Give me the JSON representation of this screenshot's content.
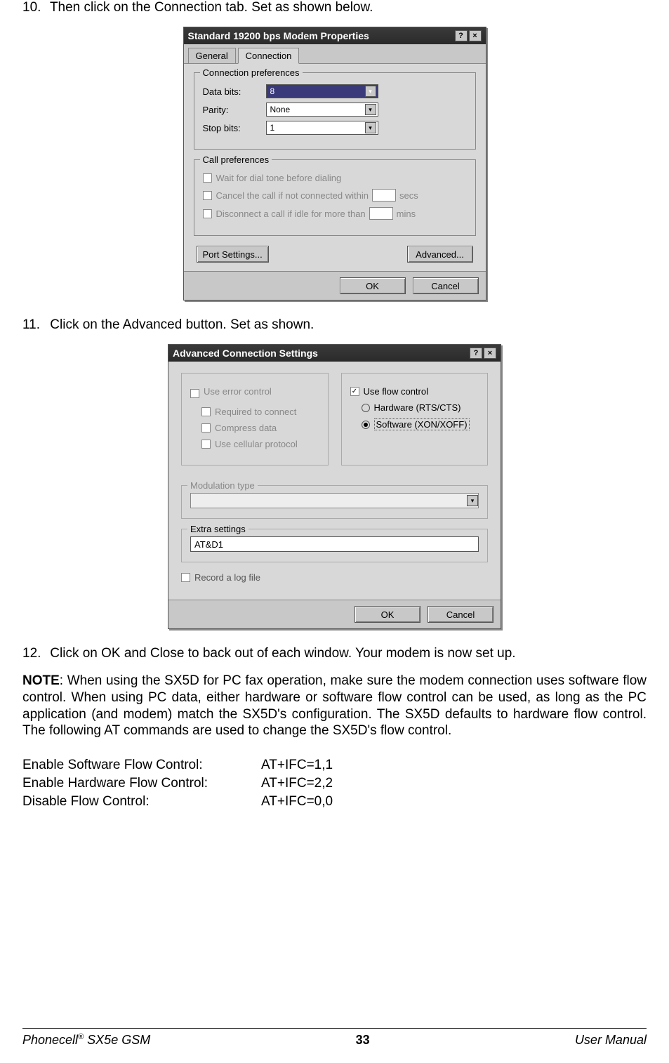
{
  "steps": {
    "s10": {
      "num": "10.",
      "text": "Then click on the Connection tab. Set as shown below."
    },
    "s11": {
      "num": "11.",
      "text": "Click on the Advanced button. Set as shown."
    },
    "s12": {
      "num": "12.",
      "text": "Click on OK and Close to back out of each window. Your modem is now set up."
    }
  },
  "dialog1": {
    "title": "Standard 19200 bps Modem Properties",
    "tabs": {
      "general": "General",
      "connection": "Connection"
    },
    "conn_pref": "Connection preferences",
    "databits": {
      "label": "Data bits:",
      "value": "8"
    },
    "parity": {
      "label": "Parity:",
      "value": "None"
    },
    "stopbits": {
      "label": "Stop bits:",
      "value": "1"
    },
    "call_pref": "Call preferences",
    "wait": "Wait for dial tone before dialing",
    "cancel": "Cancel the call if not connected within",
    "cancel_unit": "secs",
    "disconnect": "Disconnect a call if idle for more than",
    "disconnect_unit": "mins",
    "port": "Port Settings...",
    "advanced": "Advanced...",
    "ok": "OK",
    "cancelbtn": "Cancel"
  },
  "dialog2": {
    "title": "Advanced Connection Settings",
    "use_error": "Use error control",
    "required": "Required to connect",
    "compress": "Compress data",
    "cellular": "Use cellular protocol",
    "use_flow": "Use flow control",
    "hardware": "Hardware (RTS/CTS)",
    "software": "Software (XON/XOFF)",
    "modtype": "Modulation type",
    "extra": "Extra settings",
    "extra_val": "AT&D1",
    "record": "Record a log file",
    "ok": "OK",
    "cancel": "Cancel"
  },
  "note": {
    "label": "NOTE",
    "text": ": When using the SX5D for PC fax operation, make sure the modem connection uses software flow control. When using PC data, either hardware or software flow control can be used, as long as the PC application (and modem) match the SX5D's configuration. The SX5D defaults to hardware flow control. The following AT commands are used to change the SX5D's flow control."
  },
  "commands": [
    {
      "label": "Enable Software Flow Control:",
      "cmd": "AT+IFC=1,1"
    },
    {
      "label": "Enable Hardware Flow Control:",
      "cmd": "AT+IFC=2,2"
    },
    {
      "label": "Disable Flow Control:",
      "cmd": "AT+IFC=0,0"
    }
  ],
  "footer": {
    "left_a": "Phonecell",
    "left_b": " SX5e GSM",
    "page": "33",
    "right": "User Manual"
  }
}
